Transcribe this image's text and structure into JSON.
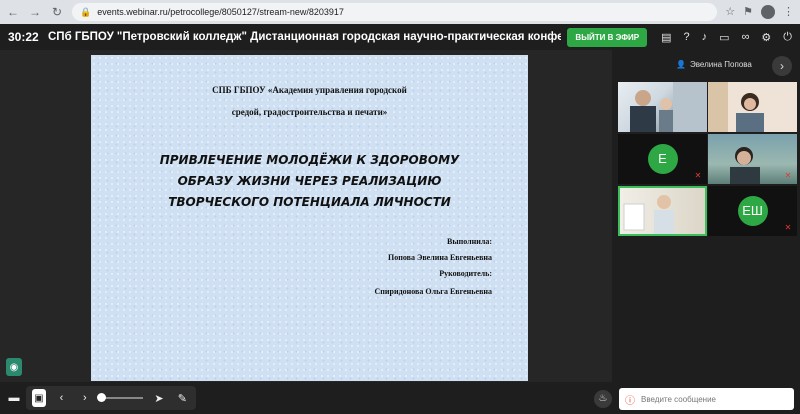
{
  "browser": {
    "url": "events.webinar.ru/petrocollege/8050127/stream-new/8203917"
  },
  "header": {
    "timer": "30:22",
    "title": "СПб ГБПОУ \"Петровский колледж\"   Дистанционная городская научно-практическая конференция \"Эколо...",
    "live_button": "ВЫЙТИ В ЭФИР"
  },
  "slide": {
    "org_line1": "СПБ ГБПОУ «Академия управления городской",
    "org_line2": "средой, градостроительства и печати»",
    "title_line1": "ПРИВЛЕЧЕНИЕ МОЛОДЁЖИ К ЗДОРОВОМУ",
    "title_line2": "ОБРАЗУ ЖИЗНИ ЧЕРЕЗ РЕАЛИЗАЦИЮ",
    "title_line3": "ТВОРЧЕСКОГО ПОТЕНЦИАЛА ЛИЧНОСТИ",
    "performer_label": "Выполнила:",
    "performer_name": "Попова Эвелина Евгеньевна",
    "supervisor_label": "Руководитель:",
    "supervisor_name": "Спиридонова Ольга Евгеньевна"
  },
  "panel": {
    "presenter_name": "Эвелина Попова",
    "tiles": [
      {
        "type": "video",
        "muted": false
      },
      {
        "type": "video",
        "muted": false
      },
      {
        "type": "avatar",
        "initials": "Е",
        "muted": true
      },
      {
        "type": "video",
        "muted": true
      },
      {
        "type": "video",
        "muted": false,
        "active": true
      },
      {
        "type": "avatar",
        "initials": "ЕШ",
        "muted": true
      }
    ]
  },
  "chat": {
    "placeholder": "Введите сообщение"
  },
  "colors": {
    "accent": "#2da845",
    "muted_icon": "#e53935"
  }
}
